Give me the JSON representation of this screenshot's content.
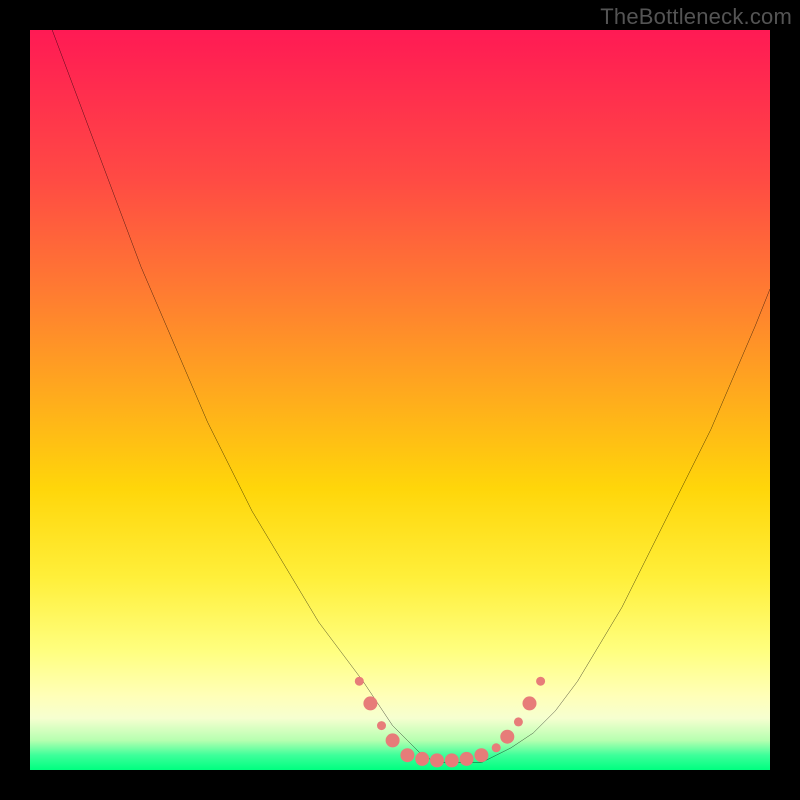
{
  "watermark": {
    "text": "TheBottleneck.com"
  },
  "chart_data": {
    "type": "line",
    "title": "",
    "xlabel": "",
    "ylabel": "",
    "xlim": [
      0,
      100
    ],
    "ylim": [
      0,
      100
    ],
    "grid": false,
    "legend": false,
    "annotations": [],
    "background_gradient_stops": [
      {
        "pos": 0,
        "color": "#ff1a54"
      },
      {
        "pos": 8,
        "color": "#ff2d4e"
      },
      {
        "pos": 20,
        "color": "#ff4a44"
      },
      {
        "pos": 35,
        "color": "#ff7a32"
      },
      {
        "pos": 48,
        "color": "#ffa61f"
      },
      {
        "pos": 62,
        "color": "#ffd60a"
      },
      {
        "pos": 74,
        "color": "#ffef3a"
      },
      {
        "pos": 84,
        "color": "#ffff80"
      },
      {
        "pos": 90,
        "color": "#ffffb8"
      },
      {
        "pos": 93,
        "color": "#f6ffd0"
      },
      {
        "pos": 96,
        "color": "#b6ffb0"
      },
      {
        "pos": 98,
        "color": "#3dff9a"
      },
      {
        "pos": 100,
        "color": "#00ff80"
      }
    ],
    "series": [
      {
        "name": "curve",
        "color": "#000000",
        "x": [
          3,
          6,
          9,
          12,
          15,
          18,
          21,
          24,
          27,
          30,
          33,
          36,
          39,
          42,
          45,
          47,
          49,
          51,
          53,
          55,
          57,
          59,
          61,
          63,
          65,
          68,
          71,
          74,
          77,
          80,
          83,
          86,
          89,
          92,
          95,
          98,
          100
        ],
        "y": [
          100,
          92,
          84,
          76,
          68,
          61,
          54,
          47,
          41,
          35,
          30,
          25,
          20,
          16,
          12,
          9,
          6,
          4,
          2,
          1,
          1,
          1,
          1,
          2,
          3,
          5,
          8,
          12,
          17,
          22,
          28,
          34,
          40,
          46,
          53,
          60,
          65
        ]
      }
    ],
    "overlay_points": {
      "name": "beads",
      "color": "#e77c79",
      "radius_major": 7,
      "radius_minor": 4.5,
      "points": [
        {
          "x": 44.5,
          "y": 12,
          "r": "minor"
        },
        {
          "x": 46.0,
          "y": 9,
          "r": "major"
        },
        {
          "x": 47.5,
          "y": 6,
          "r": "minor"
        },
        {
          "x": 49.0,
          "y": 4,
          "r": "major"
        },
        {
          "x": 51.0,
          "y": 2,
          "r": "major"
        },
        {
          "x": 53.0,
          "y": 1.5,
          "r": "major"
        },
        {
          "x": 55.0,
          "y": 1.3,
          "r": "major"
        },
        {
          "x": 57.0,
          "y": 1.3,
          "r": "major"
        },
        {
          "x": 59.0,
          "y": 1.5,
          "r": "major"
        },
        {
          "x": 61.0,
          "y": 2,
          "r": "major"
        },
        {
          "x": 63.0,
          "y": 3,
          "r": "minor"
        },
        {
          "x": 64.5,
          "y": 4.5,
          "r": "major"
        },
        {
          "x": 66.0,
          "y": 6.5,
          "r": "minor"
        },
        {
          "x": 67.5,
          "y": 9,
          "r": "major"
        },
        {
          "x": 69.0,
          "y": 12,
          "r": "minor"
        }
      ]
    }
  }
}
